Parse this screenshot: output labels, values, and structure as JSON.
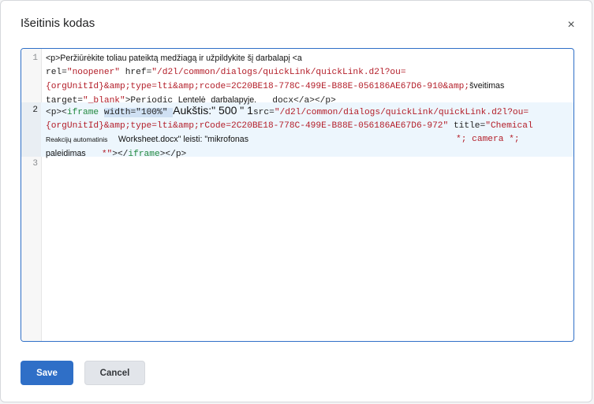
{
  "dialog": {
    "title": "Išeitinis kodas",
    "close_icon": "×"
  },
  "editor": {
    "line_numbers": [
      "1",
      "2",
      "3"
    ],
    "line1": {
      "row1_p": "<p>Peržiūrėkite toliau pateiktą medžiagą ir užpildykite šį darbalapį <a",
      "row2_rel_attr": "rel=",
      "row2_rel_val": "\"noopener\"",
      "row2_href_attr": " href=",
      "row2_href_val": "\"/d2l/common/dialogs/quickLink/quickLink.d2l?ou=",
      "row3_val": "{orgUnitId}&amp;type=lti&amp;rcode=2C20BE18-778C-499E-B88E-056186AE67D6-910&amp;",
      "row3_tail": "šveitimas",
      "row4_target_attr": "target=",
      "row4_target_val": "\"_blank\"",
      "row4_gt": ">Periodic",
      "row4_lentele": "Lentelė",
      "row4_darbalapyje": "darbalapyje.",
      "row4_docx": "docx</a></p>"
    },
    "line2": {
      "row1_open": "<p><",
      "row1_tag": "iframe",
      "row1_width": "width=\"100%\"",
      "row1_height_label": "Aukštis:\" 500 \" 1",
      "row1_src_attr": "src=",
      "row1_src_val": "\"/d2l/common/dialogs/quickLink/quickLink.d2l?ou=",
      "row2_val": "{orgUnitId}&amp;type=lti&amp;rCode=2C20BE18-778C-499E-B88E-056186AE67D6-972\"",
      "row2_title_attr": " title=",
      "row2_title_val": "\"Chemical",
      "row3_small": "Reakcijų automatinis",
      "row3_text": "Worksheet.docx\" leisti: \"mikrofonas",
      "row3_camera": "*; camera *;",
      "row4_paleidimas": "paleidimas",
      "row4_star": "*\"",
      "row4_close1": "></",
      "row4_tag": "iframe",
      "row4_close2": "></p>"
    }
  },
  "buttons": {
    "save": "Save",
    "cancel": "Cancel"
  },
  "colors": {
    "primary": "#2f6fc7",
    "string": "#b31d28",
    "tag": "#20883e"
  }
}
